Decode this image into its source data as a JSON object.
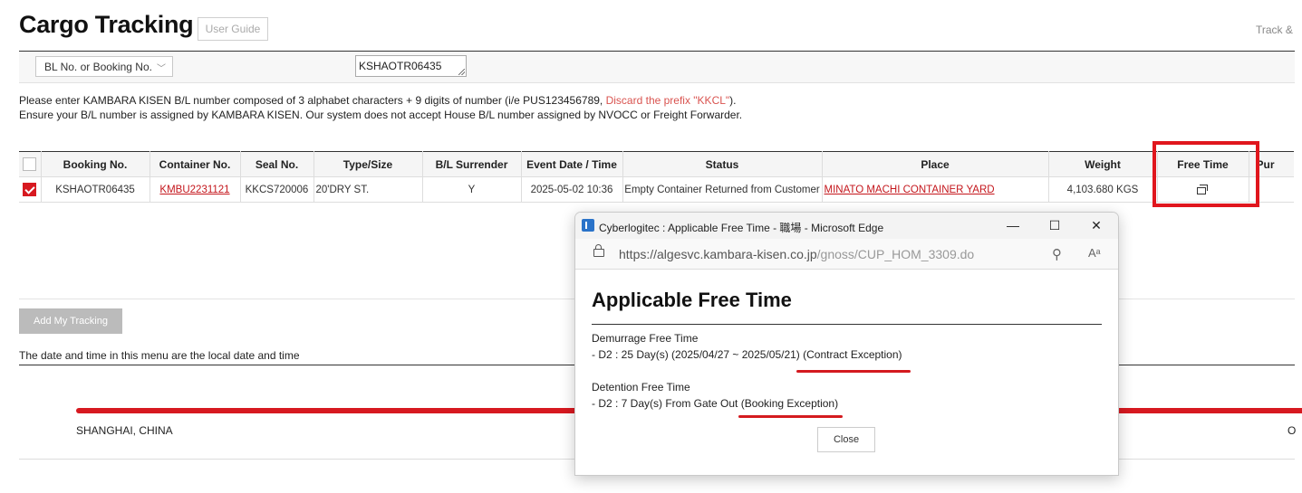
{
  "page": {
    "title": "Cargo Tracking",
    "user_guide_label": "User Guide",
    "track_link": "Track &"
  },
  "search": {
    "type_selected": "BL No. or Booking No.",
    "query_value": "KSHAOTR06435"
  },
  "notice": {
    "line1_a": "Please enter KAMBARA KISEN B/L number composed of 3 alphabet characters + 9 digits of number (i/e PUS123456789, ",
    "line1_red": "Discard the prefix \"KKCL\"",
    "line1_b": ").",
    "line2": "Ensure your B/L number is assigned by KAMBARA KISEN. Our system does not accept House B/L number assigned by NVOCC or Freight Forwarder."
  },
  "table": {
    "headers": [
      "Booking No.",
      "Container No.",
      "Seal No.",
      "Type/Size",
      "B/L Surrender",
      "Event Date / Time",
      "Status",
      "Place",
      "Weight",
      "Free Time",
      "Pur"
    ],
    "row": {
      "booking_no": "KSHAOTR06435",
      "container_no": "KMBU2231121",
      "seal_no": "KKCS720006",
      "type_size": "20'DRY ST.",
      "bl_surrender": "Y",
      "event_datetime": "2025-05-02 10:36",
      "status": "Empty Container Returned from Customer",
      "place": "MINATO MACHI CONTAINER YARD",
      "weight": "4,103.680 KGS",
      "free_time_icon": "popup-window-icon"
    }
  },
  "actions": {
    "add_tracking_label": "Add My Tracking"
  },
  "timezone_note": "The date and time in this menu are the local date and time",
  "route": {
    "origin": "SHANGHAI, CHINA",
    "destination_clipped": "O"
  },
  "popup": {
    "window_title": "Cyberlogitec : Applicable Free Time - 職場 - Microsoft Edge",
    "url_main": "https://algesvc.kambara-kisen.co.jp",
    "url_path": "/gnoss/CUP_HOM_3309.do",
    "heading": "Applicable Free Time",
    "demurrage_label": "Demurrage Free Time",
    "demurrage_value": " - D2 : 25 Day(s) (2025/04/27 ~ 2025/05/21) (Contract Exception)",
    "detention_label": "Detention Free Time",
    "detention_value": " - D2 : 7 Day(s) From Gate Out (Booking Exception)",
    "close_label": "Close"
  },
  "colors": {
    "accent_red": "#d71920",
    "annotation_red": "#e0161d"
  }
}
